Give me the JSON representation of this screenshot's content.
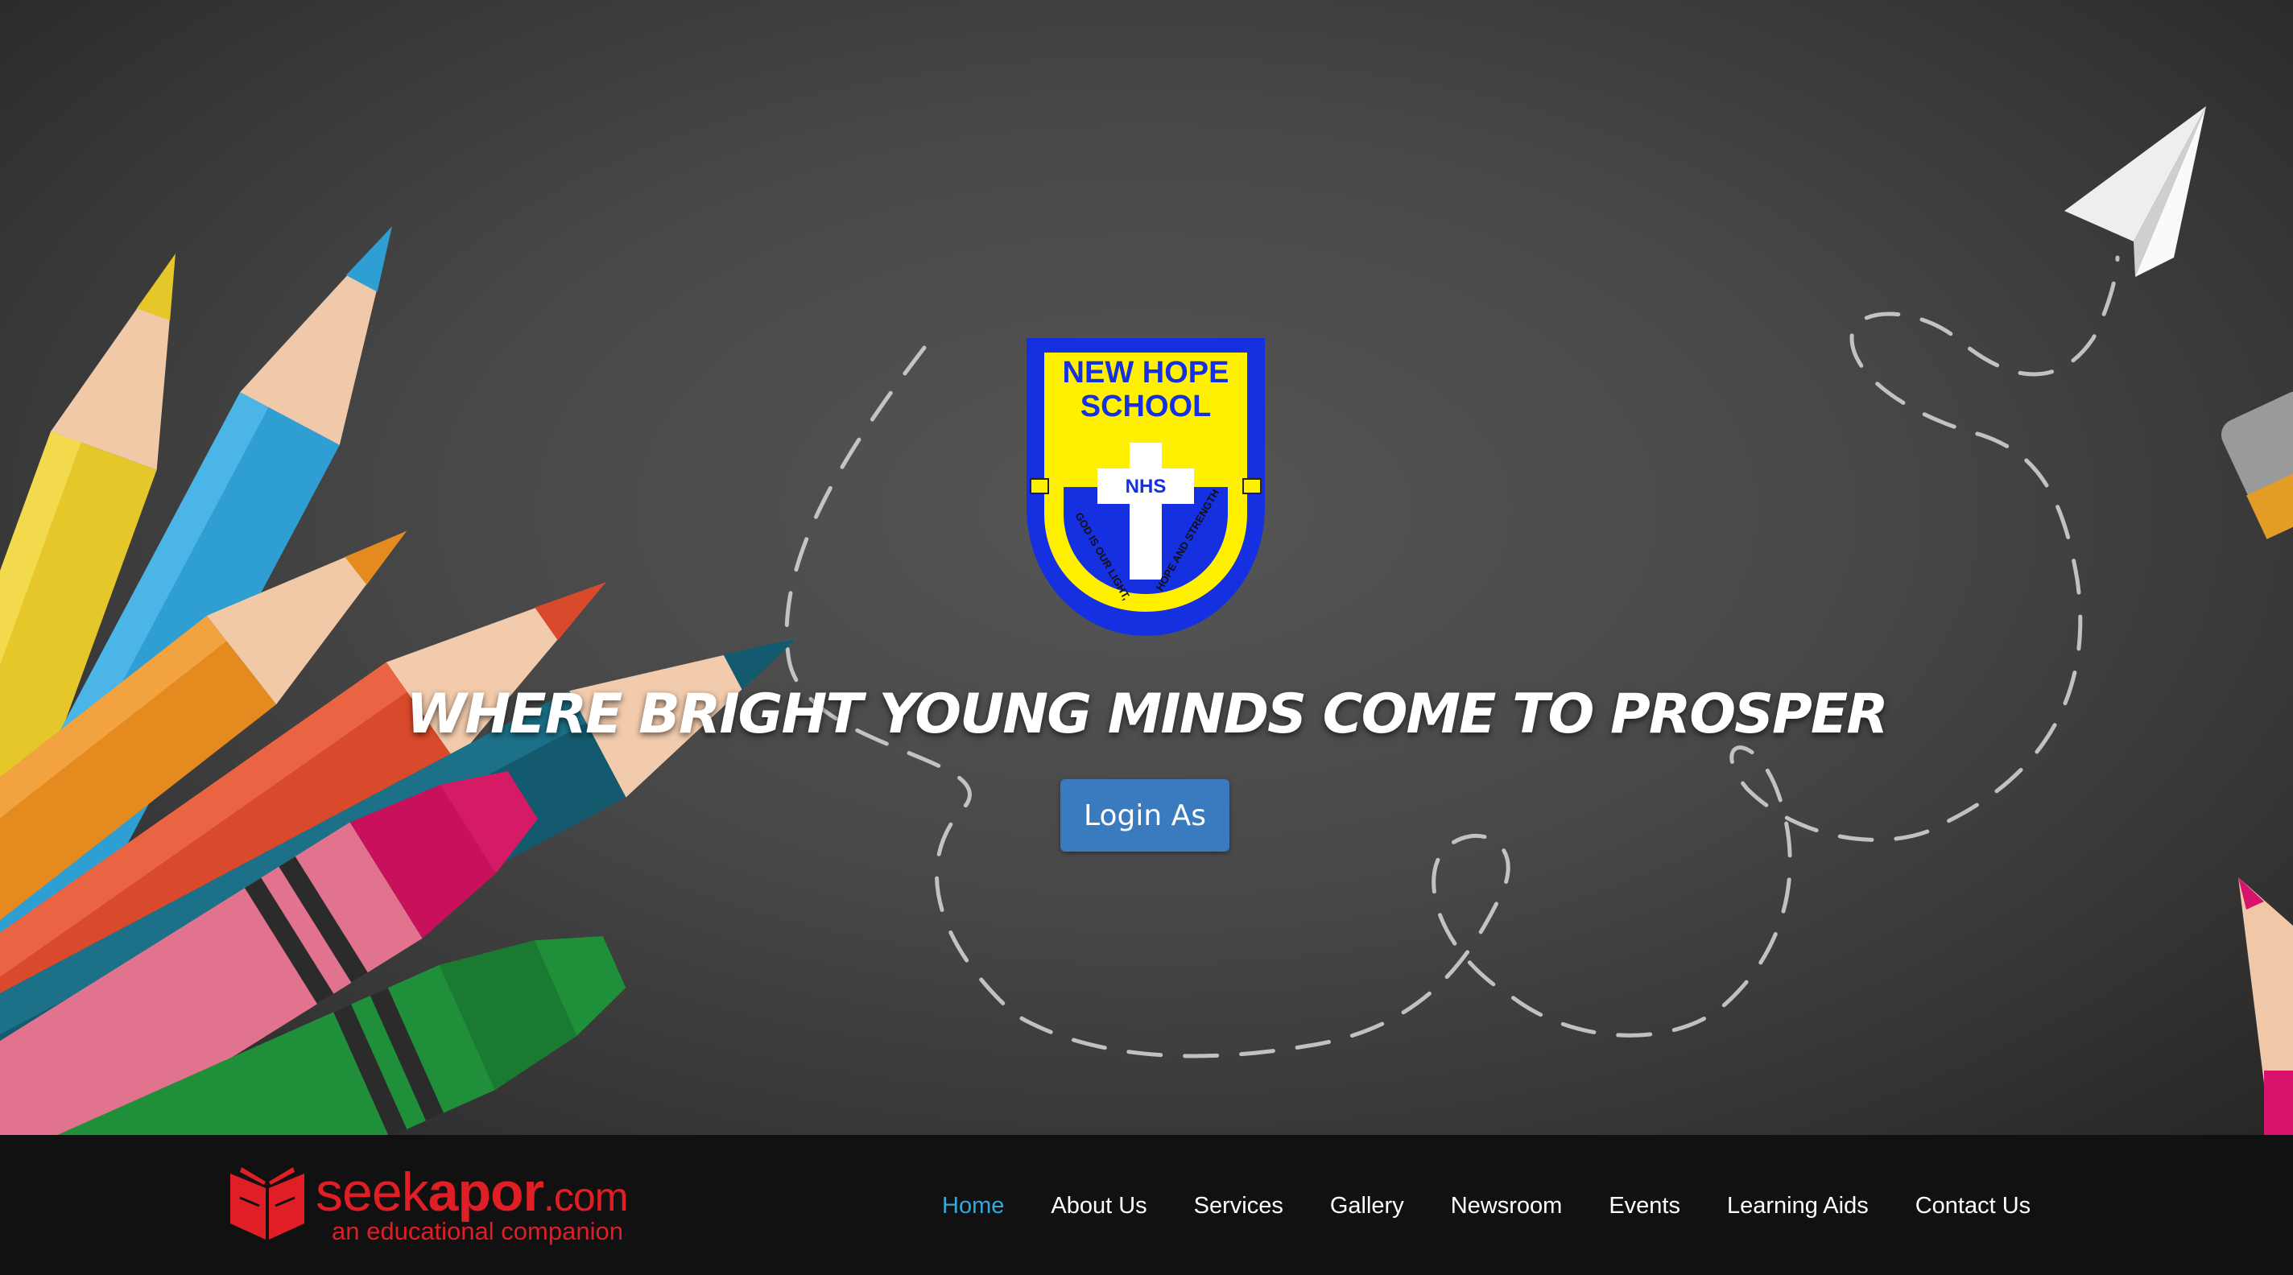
{
  "hero": {
    "crest": {
      "top_text_line1": "NEW HOPE",
      "top_text_line2": "SCHOOL",
      "cross_text": "NHS",
      "motto_left": "GOD IS OUR LIGHT,",
      "motto_right": "HOPE AND STRENGTH"
    },
    "tagline": "WHERE BRIGHT YOUNG MINDS COME TO PROSPER",
    "login_button": "Login As"
  },
  "brand": {
    "name_light": "seek",
    "name_bold": "apor",
    "name_suffix": ".com",
    "subtitle": "an educational companion",
    "icon": "open-book-icon"
  },
  "nav": {
    "items": [
      {
        "label": "Home",
        "active": true
      },
      {
        "label": "About Us"
      },
      {
        "label": "Services"
      },
      {
        "label": "Gallery"
      },
      {
        "label": "Newsroom"
      },
      {
        "label": "Events"
      },
      {
        "label": "Learning Aids"
      },
      {
        "label": "Contact Us"
      }
    ]
  },
  "colors": {
    "accent_blue": "#33a8dd",
    "button_blue": "#3a7bbf",
    "brand_red": "#e01e25",
    "crest_yellow": "#ffee00",
    "crest_blue": "#1530e0"
  }
}
